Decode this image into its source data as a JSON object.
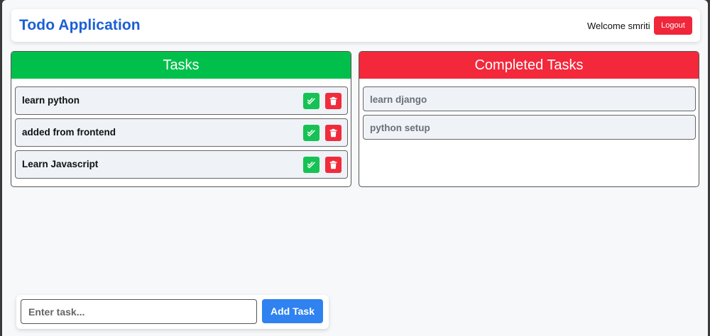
{
  "app": {
    "title": "Todo Application",
    "welcome_text": "Welcome smriti",
    "logout_label": "Logout"
  },
  "tasks_panel": {
    "heading": "Tasks",
    "items": [
      {
        "label": "learn python"
      },
      {
        "label": "added from frontend"
      },
      {
        "label": "Learn Javascript"
      }
    ],
    "complete_icon": "double-check-icon",
    "delete_icon": "trash-icon"
  },
  "completed_panel": {
    "heading": "Completed Tasks",
    "items": [
      {
        "label": "learn django"
      },
      {
        "label": "python setup"
      }
    ]
  },
  "add_task": {
    "placeholder": "Enter task...",
    "value": "",
    "button_label": "Add Task"
  },
  "colors": {
    "brand": "#1a5fd6",
    "tasks_header": "#00c04b",
    "completed_header": "#f3283b",
    "logout": "#f0263a",
    "add_button": "#2f82f0"
  }
}
